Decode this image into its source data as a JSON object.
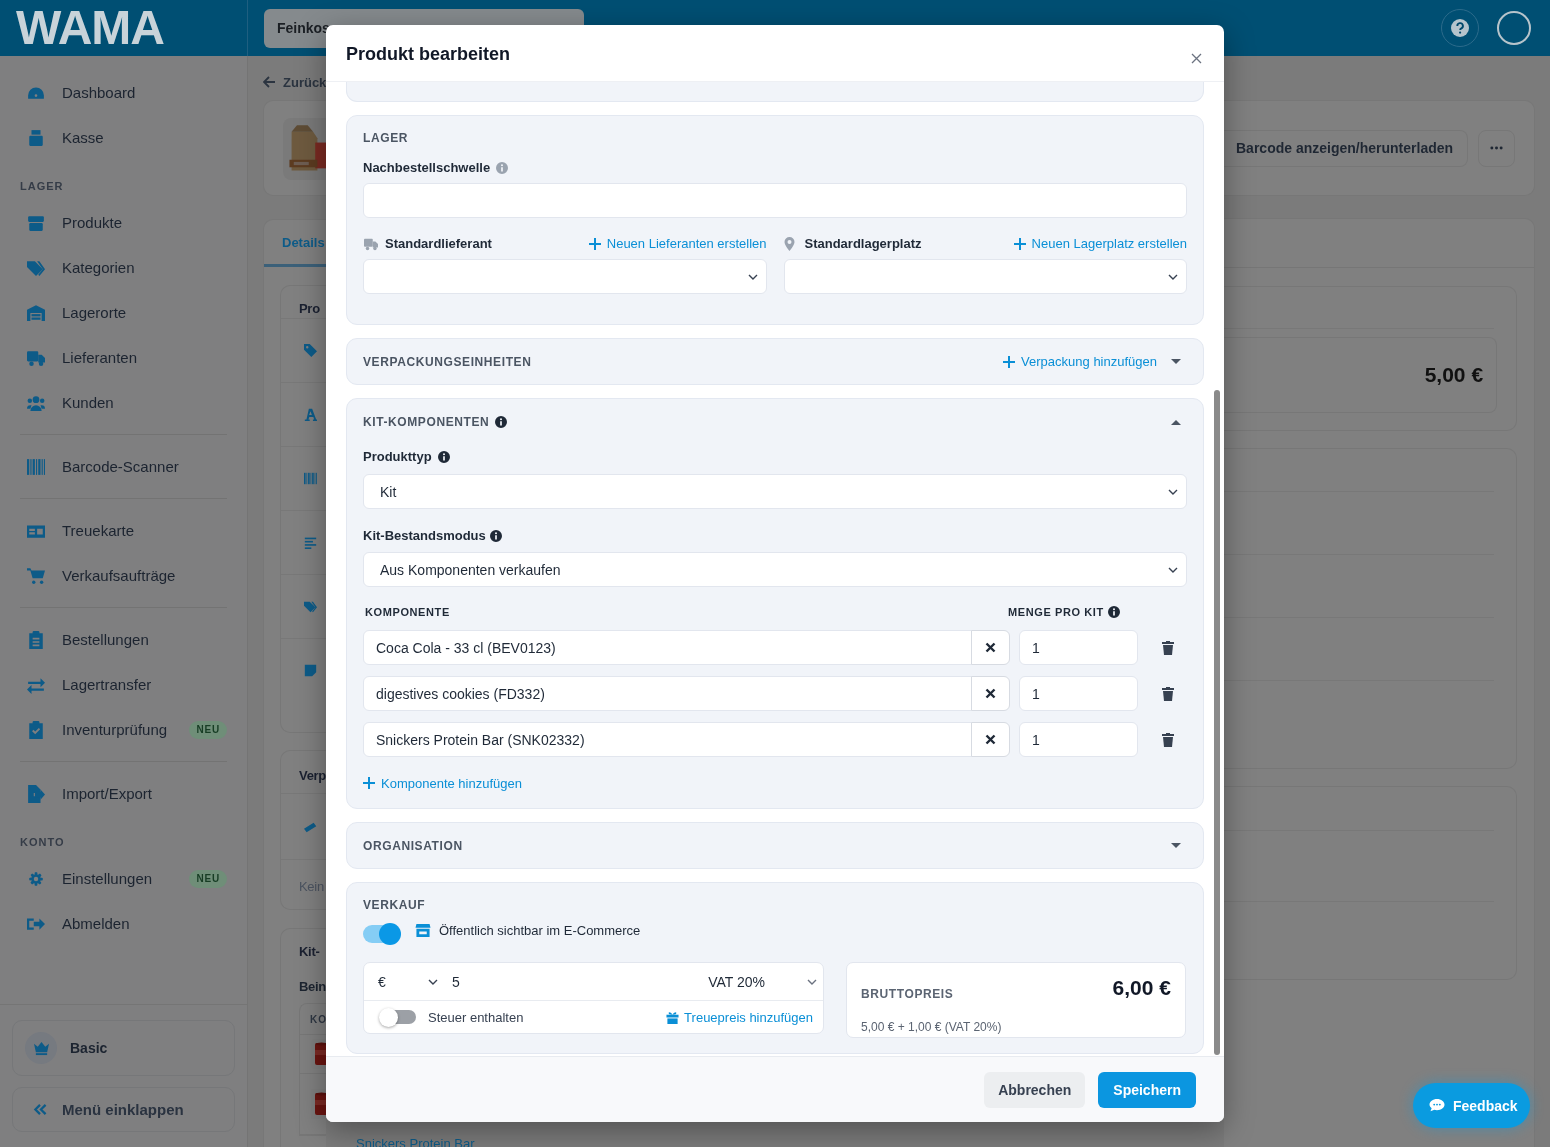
{
  "header": {
    "logo": "WAMA",
    "store_select": "Feinkos"
  },
  "sidebar": {
    "entries": [
      {
        "kind": "item",
        "label": "Dashboard"
      },
      {
        "kind": "item",
        "label": "Kasse"
      },
      {
        "kind": "heading",
        "label": "LAGER"
      },
      {
        "kind": "item",
        "label": "Produkte"
      },
      {
        "kind": "item",
        "label": "Kategorien"
      },
      {
        "kind": "item",
        "label": "Lagerorte"
      },
      {
        "kind": "item",
        "label": "Lieferanten"
      },
      {
        "kind": "item",
        "label": "Kunden"
      },
      {
        "kind": "divider"
      },
      {
        "kind": "item",
        "label": "Barcode-Scanner"
      },
      {
        "kind": "divider"
      },
      {
        "kind": "item",
        "label": "Treuekarte"
      },
      {
        "kind": "item",
        "label": "Verkaufsaufträge"
      },
      {
        "kind": "divider"
      },
      {
        "kind": "item",
        "label": "Bestellungen"
      },
      {
        "kind": "item",
        "label": "Lagertransfer"
      },
      {
        "kind": "item",
        "label": "Inventurprüfung",
        "badge": "NEU"
      },
      {
        "kind": "divider"
      },
      {
        "kind": "item",
        "label": "Import/Export"
      },
      {
        "kind": "heading",
        "label": "KONTO"
      },
      {
        "kind": "item",
        "label": "Einstellungen",
        "badge": "NEU"
      },
      {
        "kind": "item",
        "label": "Abmelden"
      }
    ],
    "plan": "Basic",
    "collapse": "Menü einklappen"
  },
  "page": {
    "back_link": "Zurück",
    "tabs": [
      {
        "label": "Details",
        "selected": true
      }
    ],
    "card_titles": [
      "Pro",
      "Verp",
      "Kit-"
    ],
    "empty_note": "Kein",
    "kit_subtitle": "Bein",
    "table_column": "KO",
    "kit_row_link": "Snickers Protein Bar",
    "barcode_button": "Barcode anzeigen/herunterladen",
    "price": "5,00 €"
  },
  "modal": {
    "title": "Produkt bearbeiten",
    "sections": [
      {
        "kind": "stock",
        "heading": "LAGER",
        "reorder_label": "Nachbestellschwelle",
        "supplier_label": "Standardlieferant",
        "supplier_link": "Neuen Lieferanten erstellen",
        "location_label": "Standardlagerplatz",
        "location_link": "Neuen Lagerplatz erstellen"
      },
      {
        "kind": "collapsible",
        "heading": "VERPACKUNGSEINHEITEN",
        "link": "Verpackung hinzufügen",
        "expanded": false
      },
      {
        "kind": "kit",
        "heading": "KIT-KOMPONENTEN",
        "expanded": true,
        "product_type_label": "Produkttyp",
        "product_type": "Kit",
        "stock_mode_label": "Kit-Bestandsmodus",
        "stock_mode": "Aus Komponenten verkaufen",
        "columns": [
          "KOMPONENTE",
          "MENGE PRO KIT"
        ],
        "components": [
          {
            "name": "Coca Cola - 33 cl (BEV0123)",
            "quantity": "1"
          },
          {
            "name": "digestives cookies (FD332)",
            "quantity": "1"
          },
          {
            "name": "Snickers Protein Bar (SNK02332)",
            "quantity": "1"
          }
        ],
        "add_link": "Komponente hinzufügen"
      },
      {
        "kind": "collapsible",
        "heading": "ORGANISATION",
        "expanded": false
      },
      {
        "kind": "sale",
        "heading": "VERKAUF",
        "ecommerce_visible": true,
        "ecommerce_label": "Öffentlich sichtbar im E-Commerce",
        "currency": "€",
        "price": "5",
        "vat": "VAT 20%",
        "tax_included": false,
        "tax_label": "Steuer enthalten",
        "loyalty_link": "Treuepreis hinzufügen",
        "gross_label": "BRUTTOPREIS",
        "gross_price": "6,00 €",
        "gross_breakdown": "5,00 € + 1,00 € (VAT 20%)"
      }
    ],
    "buttons": [
      {
        "label": "Abbrechen",
        "kind": "secondary"
      },
      {
        "label": "Speichern",
        "kind": "primary"
      }
    ]
  },
  "feedback_button": "Feedback"
}
